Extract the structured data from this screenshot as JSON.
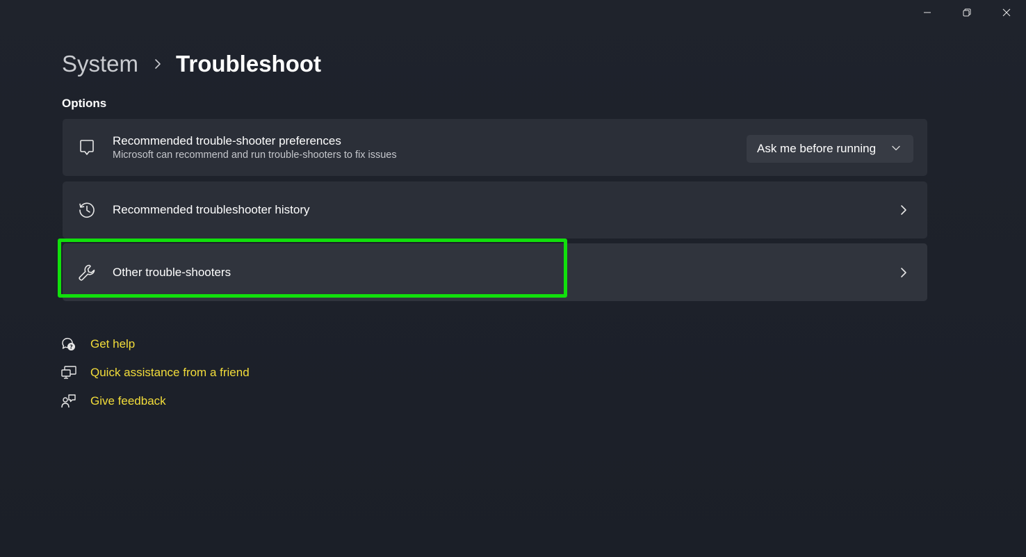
{
  "window": {
    "controls": {
      "minimize": "minimize-icon",
      "restore": "restore-icon",
      "close": "close-icon"
    }
  },
  "breadcrumb": {
    "parent": "System",
    "separator_icon": "chevron-right-icon",
    "current": "Troubleshoot"
  },
  "section": {
    "title": "Options"
  },
  "cards": {
    "preferences": {
      "icon": "chat-bubble-icon",
      "title": "Recommended trouble-shooter preferences",
      "subtitle": "Microsoft can recommend and run trouble-shooters to fix issues",
      "dropdown_value": "Ask me before running"
    },
    "history": {
      "icon": "history-icon",
      "title": "Recommended troubleshooter history"
    },
    "other": {
      "icon": "wrench-icon",
      "title": "Other trouble-shooters"
    }
  },
  "links": {
    "get_help": "Get help",
    "quick_assist": "Quick assistance from a friend",
    "feedback": "Give feedback"
  },
  "colors": {
    "background": "#1c2029",
    "card": "#2b2f38",
    "link": "#f3dd3a",
    "highlight": "#11e00c"
  }
}
